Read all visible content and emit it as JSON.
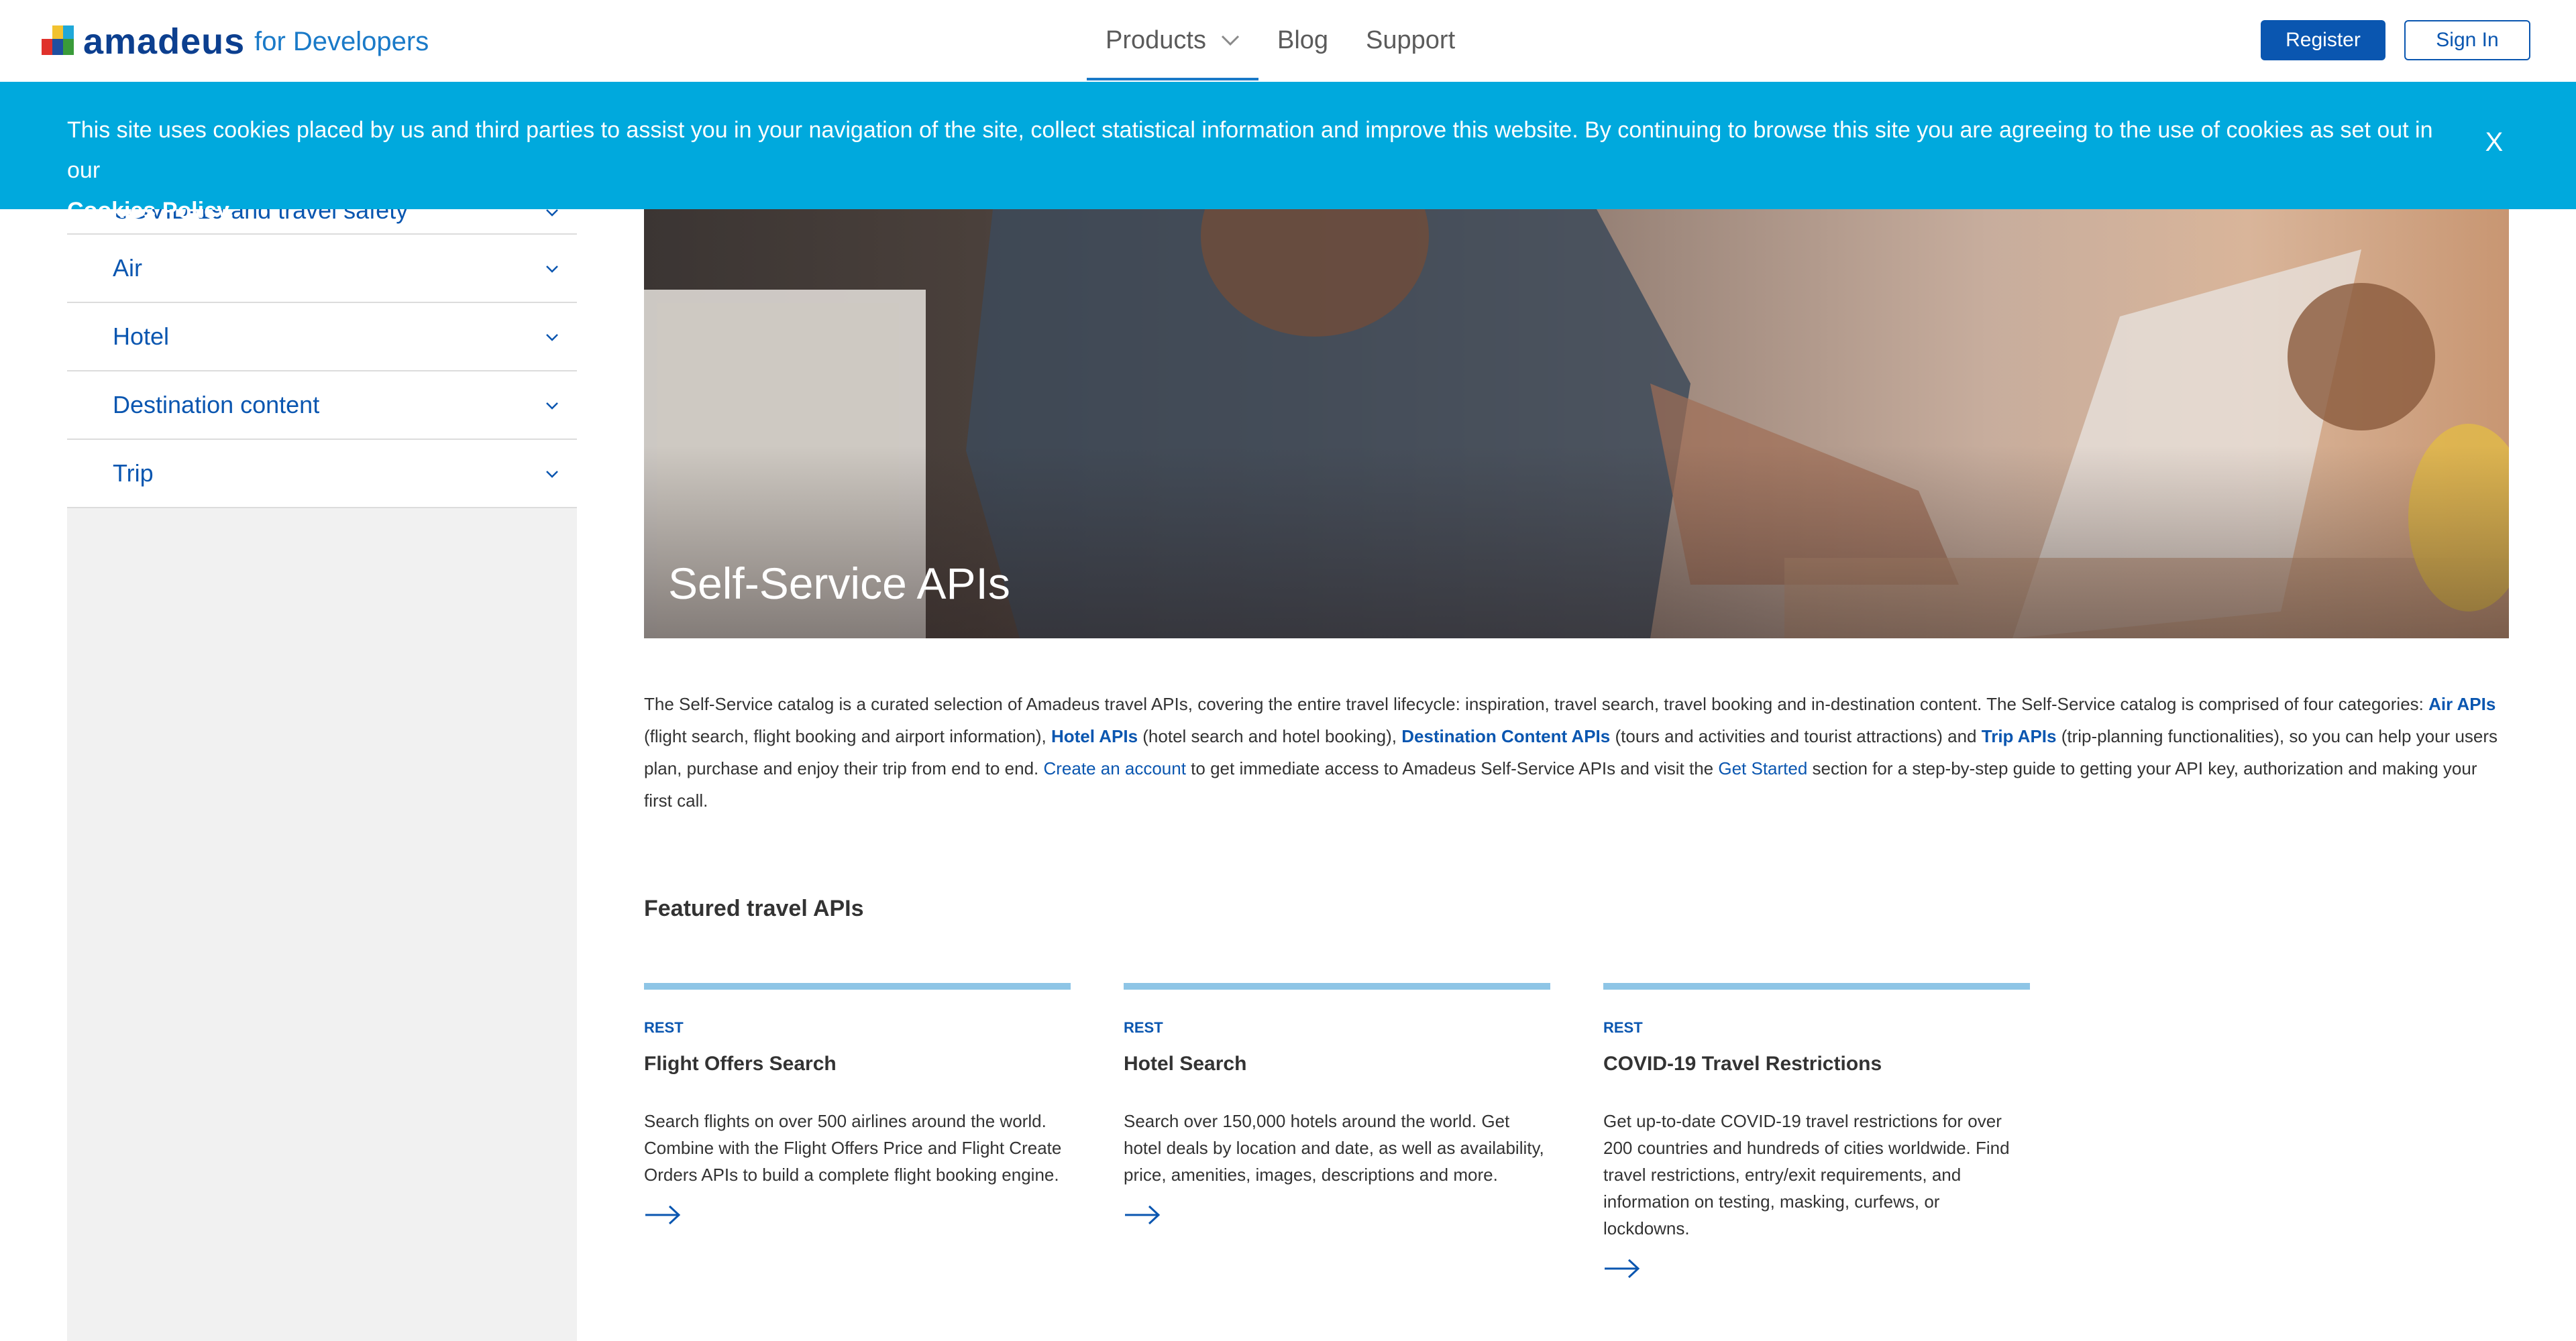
{
  "header": {
    "logo_word": "amadeus",
    "logo_sub": "for Developers",
    "nav": [
      {
        "label": "Products"
      },
      {
        "label": "Blog"
      },
      {
        "label": "Support"
      }
    ],
    "register_label": "Register",
    "signin_label": "Sign In"
  },
  "cookie_banner": {
    "text": "This site uses cookies placed by us and third parties to assist you in your navigation of the site, collect statistical information and improve this website. By continuing to browse this site you are agreeing to the use of cookies as set out in our",
    "link": "Cookies Policy.",
    "close": "X"
  },
  "sidebar": {
    "items": [
      {
        "label": "COVID-19 and travel safety"
      },
      {
        "label": "Air"
      },
      {
        "label": "Hotel"
      },
      {
        "label": "Destination content"
      },
      {
        "label": "Trip"
      }
    ]
  },
  "hero": {
    "title": "Self-Service APIs"
  },
  "description": {
    "p1": "The Self-Service catalog is a curated selection of Amadeus travel APIs, covering the entire travel lifecycle: inspiration, travel search, travel booking and in-destination content. The Self-Service catalog is comprised of four categories: ",
    "air": "Air APIs",
    "p2": " (flight search, flight booking and airport information), ",
    "hotel": "Hotel APIs",
    "p3": " (hotel search and hotel booking), ",
    "destination": "Destination Content APIs",
    "p4": " (tours and activities and tourist attractions) and ",
    "trip": "Trip APIs",
    "p5": " (trip-planning functionalities), so you can help your users plan, purchase and enjoy their trip from end to end. ",
    "create": "Create an account",
    "p6": " to get immediate access to Amadeus Self-Service APIs and visit the ",
    "getstarted": "Get Started",
    "p7": " section for a step-by-step guide to getting your API key, authorization and making your first call."
  },
  "featured": {
    "title": "Featured travel APIs",
    "cards": [
      {
        "tag": "REST",
        "title": "Flight Offers Search",
        "text": "Search flights on over 500 airlines around the world. Combine with the Flight Offers Price and Flight Create Orders APIs to build a complete flight booking engine."
      },
      {
        "tag": "REST",
        "title": "Hotel Search",
        "text": "Search over 150,000 hotels around the world. Get hotel deals by location and date, as well as availability, price, amenities, images, descriptions and more."
      },
      {
        "tag": "REST",
        "title": "COVID-19 Travel Restrictions",
        "text": "Get up-to-date COVID-19 travel restrictions for over 200 countries and hundreds of cities worldwide. Find travel restrictions, entry/exit requirements, and information on testing, masking, curfews, or lockdowns."
      }
    ]
  },
  "colors": {
    "brand_blue": "#0a56b0",
    "banner_blue": "#00a9dd",
    "card_bar": "#8ec5e6"
  }
}
